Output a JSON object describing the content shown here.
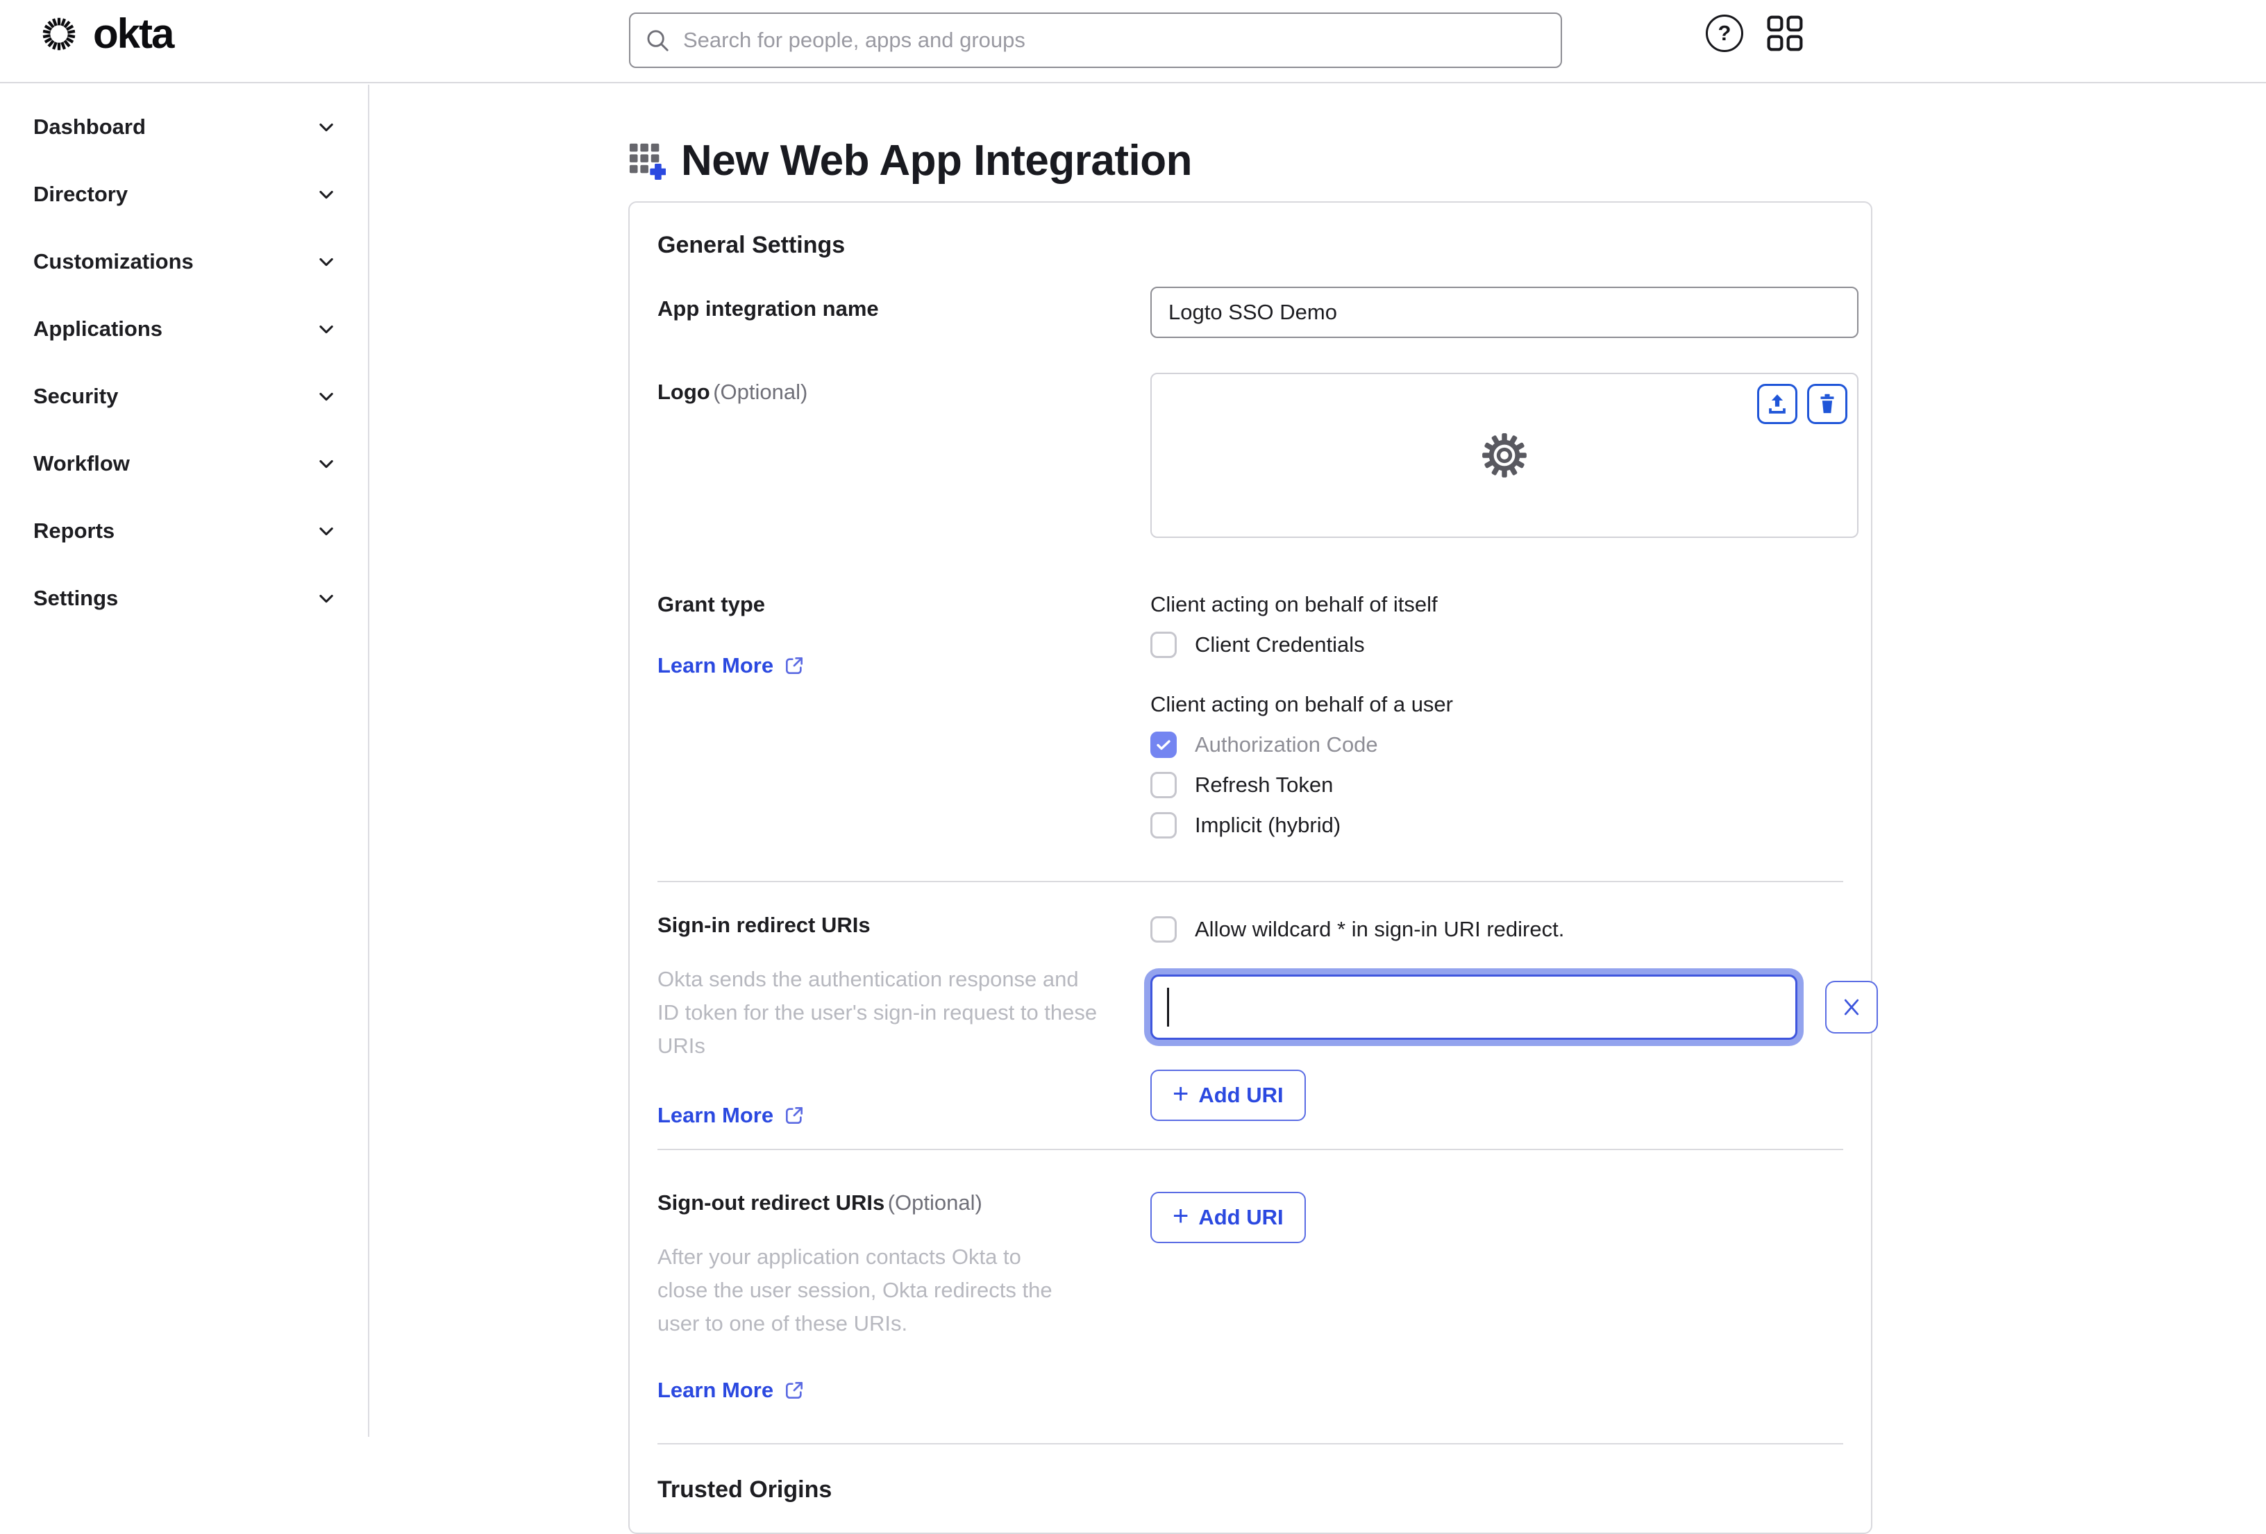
{
  "header": {
    "brand": "okta",
    "search_placeholder": "Search for people, apps and groups"
  },
  "icons": {
    "question": "?",
    "plus": "+"
  },
  "sidebar": {
    "items": [
      {
        "label": "Dashboard"
      },
      {
        "label": "Directory"
      },
      {
        "label": "Customizations"
      },
      {
        "label": "Applications"
      },
      {
        "label": "Security"
      },
      {
        "label": "Workflow"
      },
      {
        "label": "Reports"
      },
      {
        "label": "Settings"
      }
    ]
  },
  "page": {
    "title": "New Web App Integration"
  },
  "labels": {
    "learn_more": "Learn More",
    "add_uri": "Add URI",
    "optional": "(Optional)"
  },
  "card": {
    "heading": "General Settings",
    "app_name": {
      "label": "App integration name",
      "value": "Logto SSO Demo"
    },
    "logo": {
      "label": "Logo"
    },
    "grant": {
      "label": "Grant type",
      "self_title": "Client acting on behalf of itself",
      "self_options": [
        {
          "label": "Client Credentials",
          "checked": false
        }
      ],
      "user_title": "Client acting on behalf of a user",
      "user_options": [
        {
          "label": "Authorization Code",
          "checked": true,
          "disabled": true
        },
        {
          "label": "Refresh Token",
          "checked": false
        },
        {
          "label": "Implicit (hybrid)",
          "checked": false
        }
      ]
    },
    "signin": {
      "label": "Sign-in redirect URIs",
      "description": "Okta sends the authentication response and ID token for the user's sign-in request to these URIs",
      "wildcard": {
        "label": "Allow wildcard * in sign-in URI redirect.",
        "checked": false
      },
      "uri_value": ""
    },
    "signout": {
      "label": "Sign-out redirect URIs",
      "description": "After your application contacts Okta to close the user session, Okta redirects the user to one of these URIs."
    },
    "trusted_origins": "Trusted Origins"
  },
  "colors": {
    "accent_blue": "#2b49e0",
    "strong_icon_blue": "#1f55d8",
    "focus_border": "#3f56dd",
    "focus_halo": "#93a3ee",
    "checked_checkbox": "#7485f1",
    "button_border": "#5b6de4"
  }
}
